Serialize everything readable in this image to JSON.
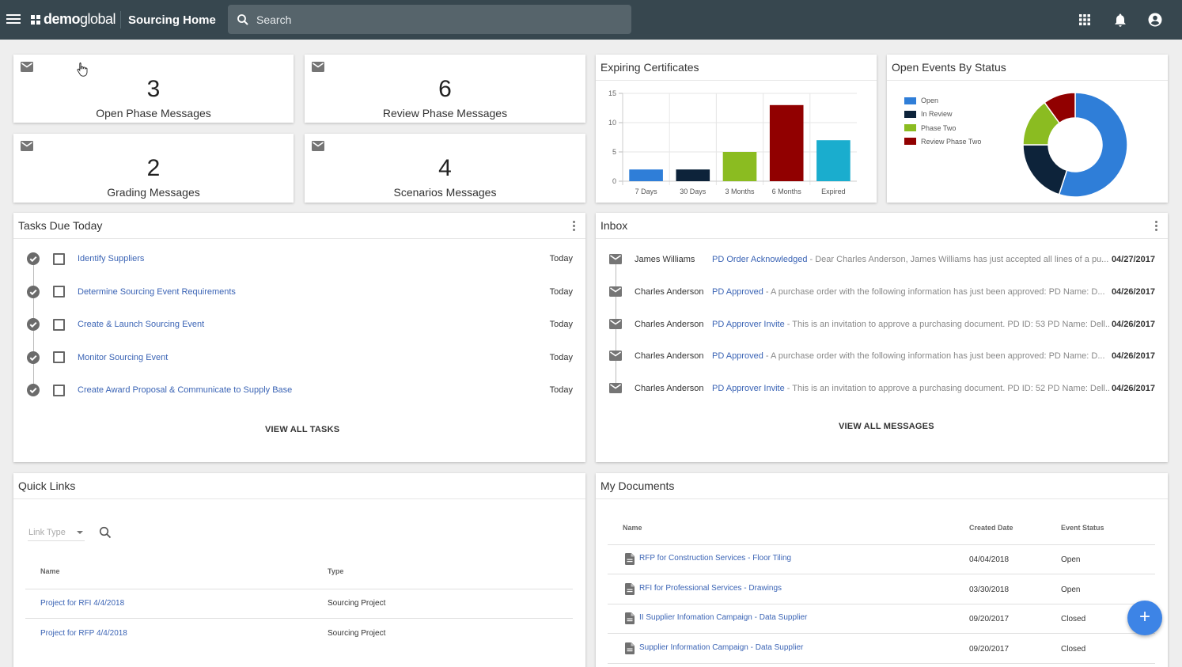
{
  "header": {
    "brand_bold": "demo",
    "brand_light": "global",
    "app_title": "Sourcing Home",
    "search_placeholder": "Search",
    "icons": [
      "menu-icon",
      "apps-grid-icon",
      "notifications-bell-icon",
      "account-circle-icon"
    ]
  },
  "stats": [
    {
      "value": "3",
      "label": "Open Phase Messages",
      "icon": "mail-icon"
    },
    {
      "value": "6",
      "label": "Review Phase Messages",
      "icon": "mail-icon"
    },
    {
      "value": "2",
      "label": "Grading Messages",
      "icon": "mail-icon"
    },
    {
      "value": "4",
      "label": "Scenarios Messages",
      "icon": "mail-icon"
    }
  ],
  "chart_data": [
    {
      "type": "bar",
      "title": "Expiring Certificates",
      "categories": [
        "7 Days",
        "30 Days",
        "3 Months",
        "6 Months",
        "Expired"
      ],
      "values": [
        2,
        2,
        5,
        13,
        7
      ],
      "colors": [
        "#2f7ed8",
        "#0d233a",
        "#8bbc21",
        "#910000",
        "#1aadce"
      ],
      "xlabel": "",
      "ylabel": "",
      "ylim": [
        0,
        15
      ],
      "yticks": [
        0,
        5,
        10,
        15
      ],
      "grid": true
    },
    {
      "type": "pie",
      "title": "Open Events By Status",
      "donut": true,
      "labels": [
        "Open",
        "In Review",
        "Phase Two",
        "Review Phase Two"
      ],
      "values": [
        11,
        4,
        3,
        2
      ],
      "colors": [
        "#2f7ed8",
        "#0d233a",
        "#8bbc21",
        "#910000"
      ],
      "legend": "left"
    }
  ],
  "tasks": {
    "title": "Tasks Due Today",
    "items": [
      {
        "label": "Identify Suppliers",
        "due": "Today"
      },
      {
        "label": "Determine Sourcing Event Requirements",
        "due": "Today"
      },
      {
        "label": "Create & Launch Sourcing Event",
        "due": "Today"
      },
      {
        "label": "Monitor Sourcing Event",
        "due": "Today"
      },
      {
        "label": "Create Award Proposal & Communicate to Supply Base",
        "due": "Today"
      }
    ],
    "view_all": "VIEW ALL TASKS"
  },
  "inbox": {
    "title": "Inbox",
    "items": [
      {
        "from": "James Williams",
        "subject": "PD Order Acknowledged",
        "body": " - Dear Charles Anderson, James Williams has just accepted all lines of a pu...",
        "date": "04/27/2017"
      },
      {
        "from": "Charles Anderson",
        "subject": "PD Approved",
        "body": " - A purchase order with the following information has just been approved: PD Name: D...",
        "date": "04/26/2017"
      },
      {
        "from": "Charles Anderson",
        "subject": "PD Approver Invite",
        "body": " - This is an invitation to approve a purchasing document. PD ID: 53 PD Name: Dell...",
        "date": "04/26/2017"
      },
      {
        "from": "Charles Anderson",
        "subject": "PD Approved",
        "body": " - A purchase order with the following information has just been approved: PD Name: D...",
        "date": "04/26/2017"
      },
      {
        "from": "Charles Anderson",
        "subject": "PD Approver Invite",
        "body": " - This is an invitation to approve a purchasing document. PD ID: 52 PD Name: Dell...",
        "date": "04/26/2017"
      }
    ],
    "view_all": "VIEW ALL MESSAGES"
  },
  "quick_links": {
    "title": "Quick Links",
    "filter_placeholder": "Link Type",
    "columns": [
      "Name",
      "Type"
    ],
    "rows": [
      {
        "name": "Project for RFI 4/4/2018",
        "type": "Sourcing Project"
      },
      {
        "name": "Project for RFP 4/4/2018",
        "type": "Sourcing Project"
      }
    ]
  },
  "documents": {
    "title": "My Documents",
    "columns": [
      "Name",
      "Created Date",
      "Event Status"
    ],
    "rows": [
      {
        "name": "RFP for Construction Services - Floor Tiling",
        "created": "04/04/2018",
        "status": "Open"
      },
      {
        "name": "RFI for Professional Services - Drawings",
        "created": "03/30/2018",
        "status": "Open"
      },
      {
        "name": "II Supplier Infomation Campaign - Data Supplier",
        "created": "09/20/2017",
        "status": "Closed"
      },
      {
        "name": "Supplier Information Campaign - Data Supplier",
        "created": "09/20/2017",
        "status": "Closed"
      }
    ]
  },
  "fab_label": "+",
  "colors": {
    "topbar": "#37474f",
    "link": "#3b64b5",
    "fab": "#3d84e6"
  }
}
